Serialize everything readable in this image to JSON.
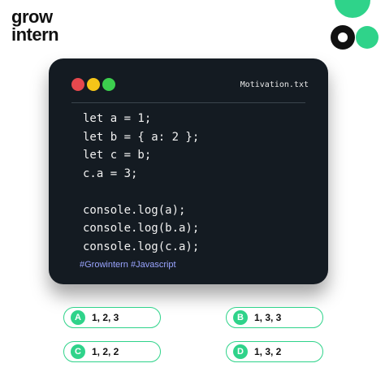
{
  "brand": {
    "line1": "grow",
    "line2": "intern"
  },
  "colors": {
    "accent": "#2fd38a",
    "card_bg": "#141b22",
    "dot_red": "#e5484d",
    "dot_yellow": "#f5c518",
    "dot_green": "#3ccf4e",
    "hashtag": "#9aa4ff"
  },
  "editor": {
    "filename": "Motivation.txt",
    "lines": [
      "let a = 1;",
      "let b = { a: 2 };",
      "let c = b;",
      "c.a = 3;",
      "",
      "console.log(a);",
      "console.log(b.a);",
      "console.log(c.a);"
    ],
    "hashtags": "#Growintern #Javascript"
  },
  "options": [
    {
      "letter": "A",
      "text": "1, 2, 3"
    },
    {
      "letter": "B",
      "text": "1, 3, 3"
    },
    {
      "letter": "C",
      "text": "1, 2, 2"
    },
    {
      "letter": "D",
      "text": "1, 3, 2"
    }
  ]
}
